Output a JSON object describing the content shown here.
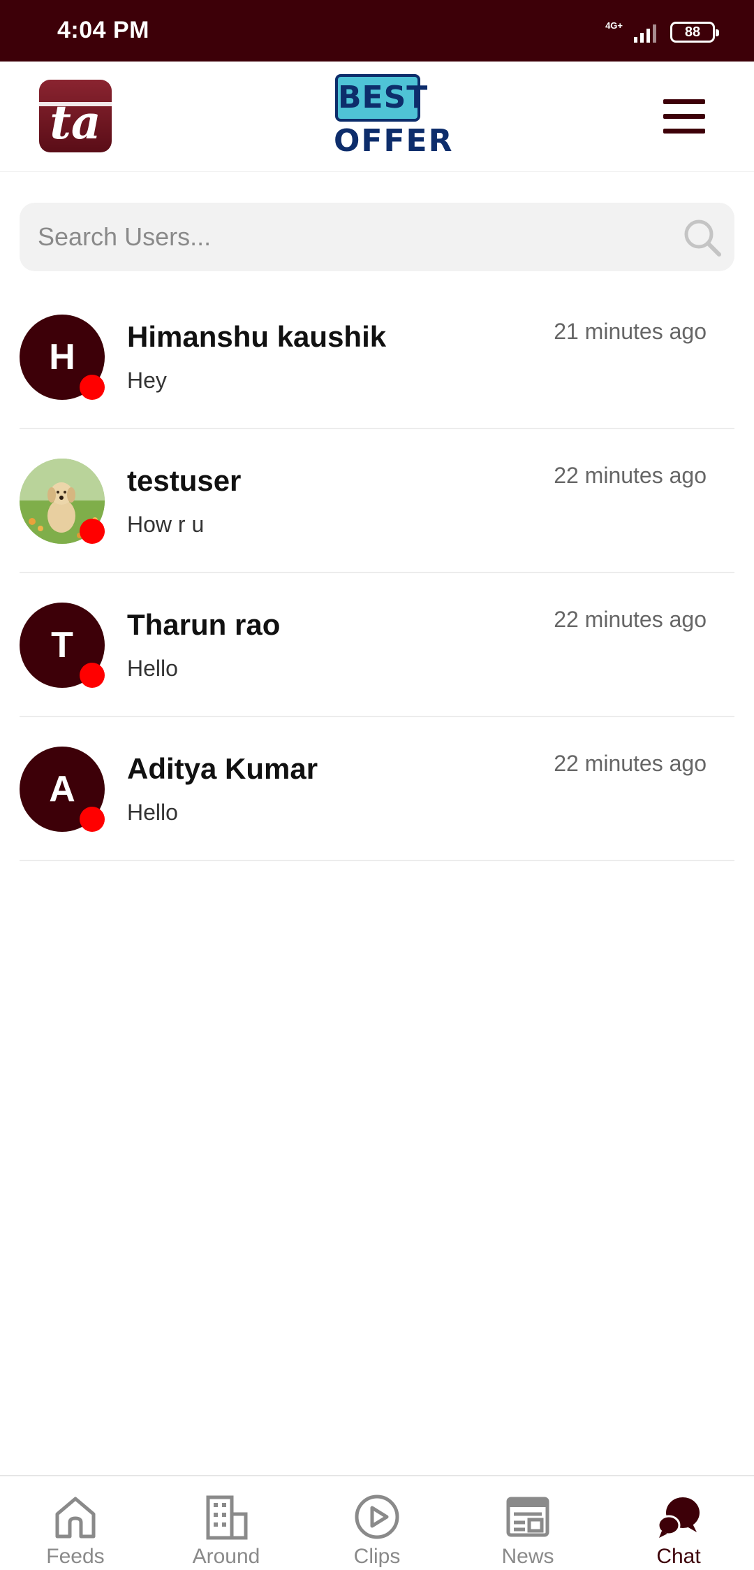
{
  "status_bar": {
    "time": "4:04 PM",
    "network": "4G+",
    "battery": "88"
  },
  "header": {
    "logo_text": "ta",
    "brand_top": "BEST",
    "brand_bottom": "OFFER"
  },
  "search": {
    "placeholder": "Search Users..."
  },
  "chats": [
    {
      "initial": "H",
      "name": "Himanshu kaushik",
      "message": "Hey",
      "time": "21 minutes ago"
    },
    {
      "initial": "",
      "name": "testuser",
      "message": "How r u",
      "time": "22 minutes ago"
    },
    {
      "initial": "T",
      "name": "Tharun rao",
      "message": "Hello",
      "time": "22 minutes ago"
    },
    {
      "initial": "A",
      "name": "Aditya Kumar",
      "message": "Hello",
      "time": "22 minutes ago"
    }
  ],
  "nav": [
    {
      "label": "Feeds",
      "icon": "home-icon"
    },
    {
      "label": "Around",
      "icon": "building-icon"
    },
    {
      "label": "Clips",
      "icon": "play-icon"
    },
    {
      "label": "News",
      "icon": "newspaper-icon"
    },
    {
      "label": "Chat",
      "icon": "chat-bubble-icon",
      "active": true
    }
  ],
  "colors": {
    "primary": "#3d0008",
    "online": "#ff0000",
    "inactive_nav": "#8a8a8a"
  }
}
